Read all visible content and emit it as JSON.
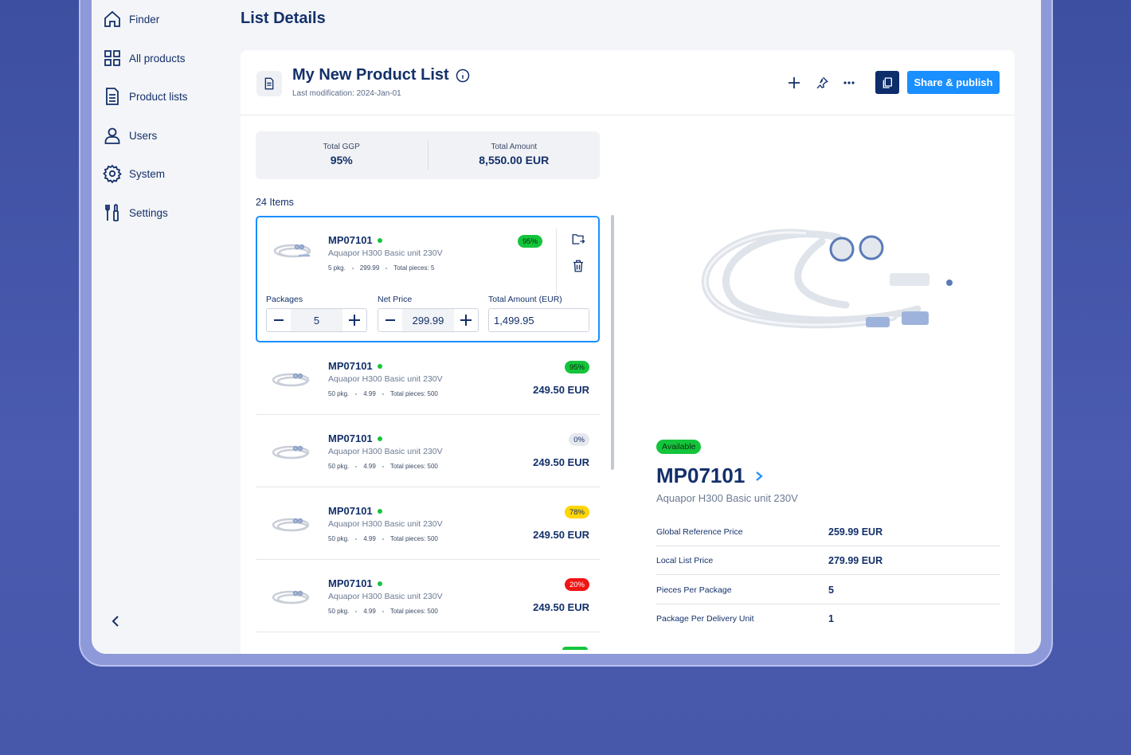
{
  "sidebar": {
    "items": [
      {
        "label": "Finder",
        "icon": "home-icon"
      },
      {
        "label": "All products",
        "icon": "grid-icon"
      },
      {
        "label": "Product lists",
        "icon": "document-icon"
      },
      {
        "label": "Users",
        "icon": "user-icon"
      },
      {
        "label": "System",
        "icon": "gear-icon"
      },
      {
        "label": "Settings",
        "icon": "tools-icon"
      }
    ]
  },
  "page": {
    "title": "List Details"
  },
  "list": {
    "title": "My New Product List",
    "last_modification": "Last modification: 2024-Jan-01",
    "share_label": "Share & publish"
  },
  "totals": {
    "ggp_label": "Total GGP",
    "ggp_value": "95%",
    "amount_label": "Total Amount",
    "amount_value": "8,550.00 EUR"
  },
  "items_count": "24 Items",
  "selected_item": {
    "code": "MP07101",
    "name": "Aquapor H300 Basic unit 230V",
    "pkg": "5 pkg.",
    "unit_price": "299.99",
    "pieces": "Total pieces: 5",
    "badge": "95%",
    "packages_label": "Packages",
    "packages_value": "5",
    "net_price_label": "Net Price",
    "net_price_value": "299.99",
    "total_label": "Total Amount (EUR)",
    "total_value": "1,499.95"
  },
  "rows": [
    {
      "code": "MP07101",
      "name": "Aquapor H300 Basic unit 230V",
      "pkg": "50 pkg.",
      "unit_price": "4.99",
      "pieces": "Total pieces: 500",
      "badge": "95%",
      "price": "249.50 EUR"
    },
    {
      "code": "MP07101",
      "name": "Aquapor H300 Basic unit 230V",
      "pkg": "50 pkg.",
      "unit_price": "4.99",
      "pieces": "Total pieces: 500",
      "badge": "0%",
      "price": "249.50 EUR"
    },
    {
      "code": "MP07101",
      "name": "Aquapor H300 Basic unit 230V",
      "pkg": "50 pkg.",
      "unit_price": "4.99",
      "pieces": "Total pieces: 500",
      "badge": "78%",
      "price": "249.50 EUR"
    },
    {
      "code": "MP07101",
      "name": "Aquapor H300 Basic unit 230V",
      "pkg": "50 pkg.",
      "unit_price": "4.99",
      "pieces": "Total pieces: 500",
      "badge": "20%",
      "price": "249.50 EUR"
    }
  ],
  "detail": {
    "status": "Available",
    "code": "MP07101",
    "name": "Aquapor H300 Basic unit 230V",
    "specs": [
      {
        "label": "Global Reference Price",
        "value": "259.99 EUR"
      },
      {
        "label": "Local List Price",
        "value": "279.99 EUR"
      },
      {
        "label": "Pieces Per Package",
        "value": "5"
      },
      {
        "label": "Package Per Delivery Unit",
        "value": "1"
      }
    ]
  },
  "colors": {
    "accent": "#1a8fff",
    "navy": "#13306a",
    "green": "#14c53c",
    "yellow": "#ffd600",
    "red": "#f01515"
  }
}
